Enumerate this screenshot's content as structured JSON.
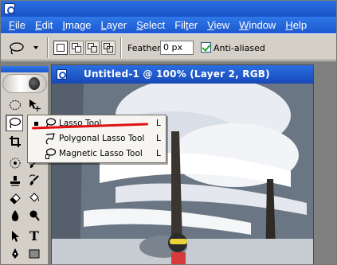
{
  "menu": [
    {
      "label": "File",
      "underline": "F",
      "rest": "ile"
    },
    {
      "label": "Edit",
      "underline": "E",
      "rest": "dit"
    },
    {
      "label": "Image",
      "underline": "I",
      "rest": "mage"
    },
    {
      "label": "Layer",
      "underline": "L",
      "rest": "ayer"
    },
    {
      "label": "Select",
      "underline": "S",
      "rest": "elect"
    },
    {
      "label": "Filter",
      "underline": "",
      "pre": "Fil",
      "u2": "t",
      "post": "er"
    },
    {
      "label": "View",
      "underline": "V",
      "rest": "iew"
    },
    {
      "label": "Window",
      "underline": "W",
      "rest": "indow"
    },
    {
      "label": "Help",
      "underline": "H",
      "rest": "elp"
    }
  ],
  "options": {
    "feather_label": "Feather:",
    "feather_value": "0 px",
    "antialiased_label": "Anti-aliased",
    "antialiased_checked": true
  },
  "document": {
    "title": "Untitled-1 @ 100% (Layer 2, RGB)"
  },
  "flyout": {
    "items": [
      {
        "label": "Lasso Tool",
        "shortcut": "L",
        "selected": true,
        "icon": "lasso-icon"
      },
      {
        "label": "Polygonal Lasso Tool",
        "shortcut": "L",
        "selected": false,
        "icon": "polygonal-lasso-icon"
      },
      {
        "label": "Magnetic Lasso Tool",
        "shortcut": "L",
        "selected": false,
        "icon": "magnetic-lasso-icon"
      }
    ]
  },
  "toolbox": {
    "type_tool_glyph": "T"
  },
  "colors": {
    "titlebar": "#1d58cf",
    "chrome": "#d4d0c8",
    "annotation": "#e01010"
  }
}
